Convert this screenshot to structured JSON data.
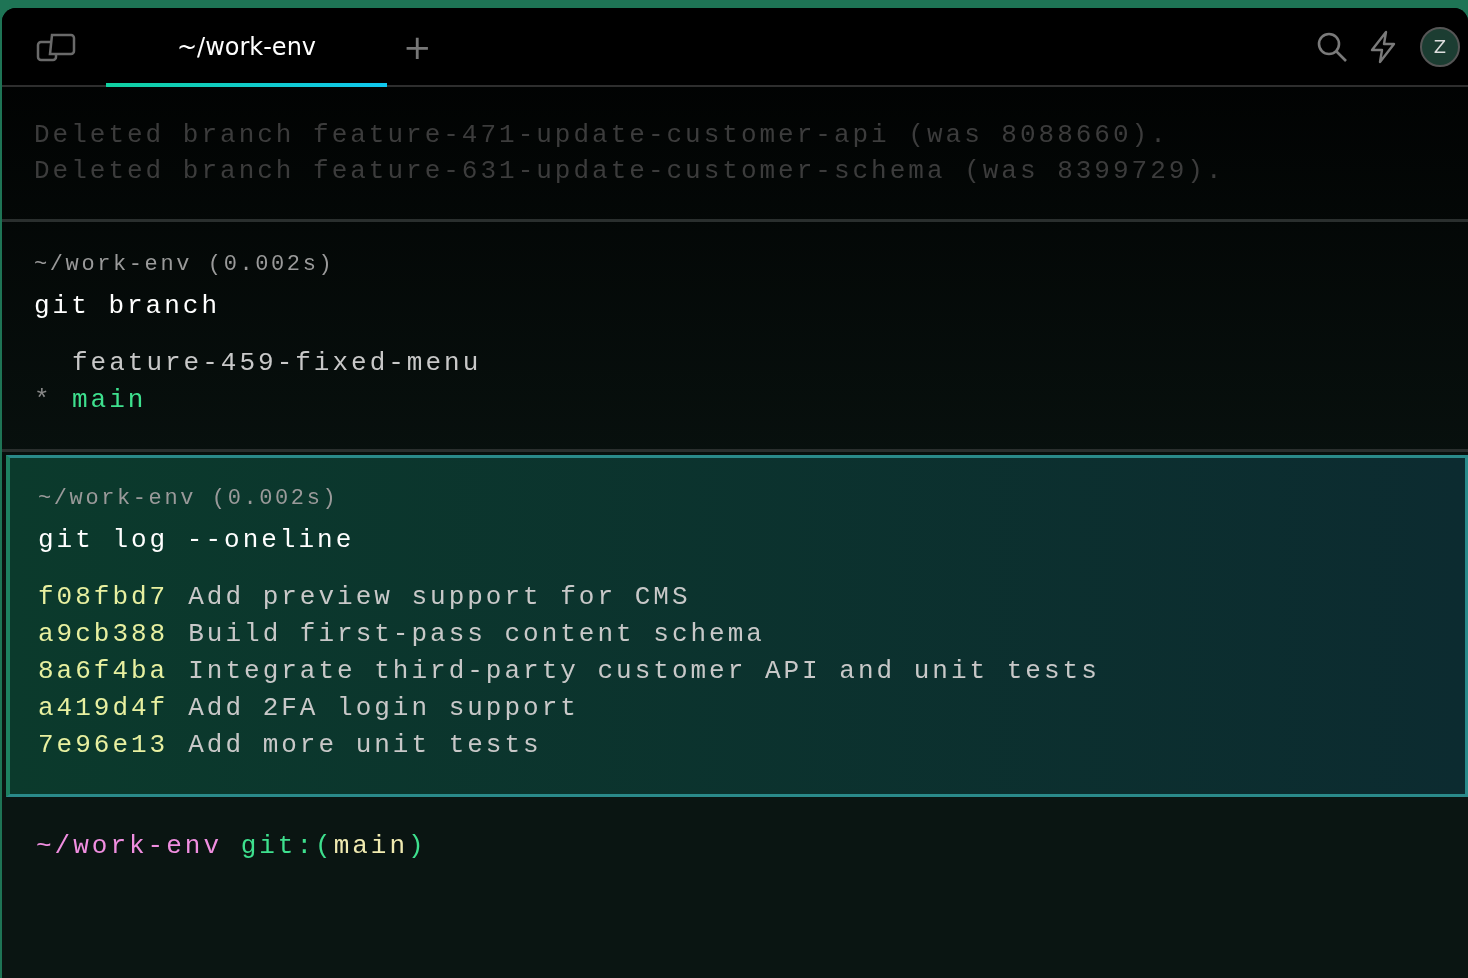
{
  "tabs": [
    {
      "label": "~/work-env",
      "selected": true
    }
  ],
  "new_tab": "+",
  "avatar": "Z",
  "blocks": [
    {
      "selected": false,
      "output": [
        {
          "kind": "dim",
          "text": "Deleted branch feature-471-update-customer-api (was 8088660)."
        },
        {
          "kind": "dim",
          "text": "Deleted branch feature-631-update-customer-schema (was 8399729)."
        }
      ]
    },
    {
      "selected": false,
      "header": "~/work-env (0.002s)",
      "command": "git branch",
      "output": [
        {
          "kind": "branch",
          "name": "feature-459-fixed-menu",
          "current": false
        },
        {
          "kind": "branch",
          "marker": "*",
          "name": "main",
          "current": true
        }
      ]
    },
    {
      "selected": true,
      "header": "~/work-env (0.002s)",
      "command": "git log --oneline",
      "output": [
        {
          "kind": "commit",
          "hash": "f08fbd7",
          "message": "Add preview support for CMS"
        },
        {
          "kind": "commit",
          "hash": "a9cb388",
          "message": "Build first-pass content schema"
        },
        {
          "kind": "commit",
          "hash": "8a6f4ba",
          "message": "Integrate third-party customer API and unit tests"
        },
        {
          "kind": "commit",
          "hash": "a419d4f",
          "message": "Add 2FA login support"
        },
        {
          "kind": "commit",
          "hash": "7e96e13",
          "message": "Add more unit tests"
        }
      ]
    }
  ],
  "prompt": [
    {
      "text": "~/work-env",
      "color": "#f08ee0"
    },
    {
      "text": " git:(",
      "color": "#3ee08e"
    },
    {
      "text": "main",
      "color": "#f0eab0"
    },
    {
      "text": ")",
      "color": "#3ee08e"
    }
  ]
}
